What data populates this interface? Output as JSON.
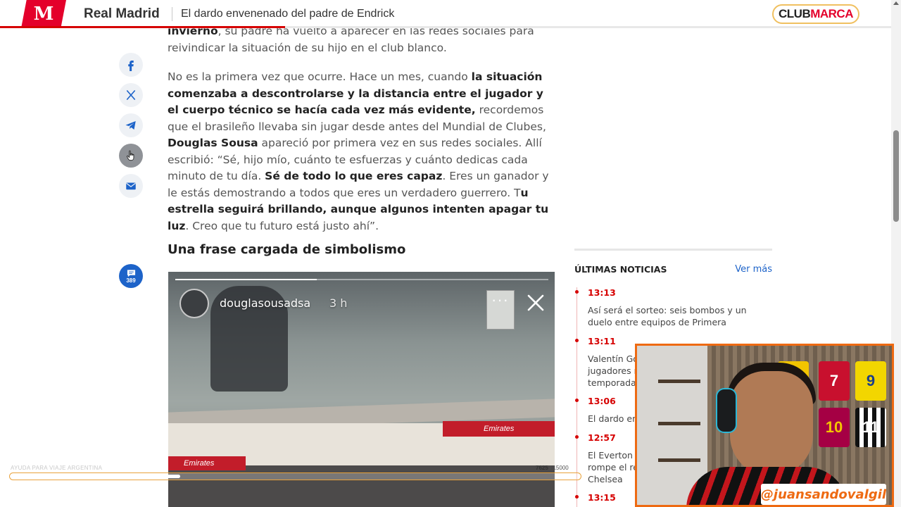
{
  "header": {
    "logo_letter": "M",
    "section": "Real Madrid",
    "article_title": "El dardo envenenado del padre de Endrick",
    "club_brand_part1": "CLUB",
    "club_brand_part2": "MARCA"
  },
  "share_rail": {
    "buttons": [
      "facebook-icon",
      "x-icon",
      "telegram-icon",
      "whatsapp-icon",
      "email-icon"
    ],
    "comments_count": "389"
  },
  "article": {
    "p1_bold": "invierno",
    "p1_rest": ", su padre ha vuelto a aparecer en las redes sociales para reivindicar la situación de su hijo en el club blanco.",
    "p2": {
      "a": "No es la primera vez que ocurre. Hace un mes, cuando ",
      "b": "la situación comenzaba a descontrolarse y la distancia entre el jugador y el cuerpo técnico se hacía cada vez más evidente,",
      "c": " recordemos que el brasileño llevaba sin jugar desde antes del Mundial de Clubes, ",
      "d": "Douglas Sousa",
      "e": " apareció por primera vez en sus redes sociales. Allí escribió: “Sé, hijo mío, cuánto te esfuerzas y cuánto dedicas cada minuto de tu día. ",
      "f": "Sé de todo lo que eres capaz",
      "g": ". Eres un ganador y le estás demostrando a todos que eres un verdadero guerrero. T",
      "h": "u estrella seguirá brillando, aunque algunos intenten apagar tu luz",
      "i": ". Creo que tu futuro está justo ahí”."
    },
    "subheading": "Una frase cargada de simbolismo"
  },
  "story_embed": {
    "username": "douglasousadsa",
    "time": "3 h",
    "more": "···",
    "brand_text": "Emirates",
    "progress": 0.38
  },
  "latest_news": {
    "heading": "ÚLTIMAS NOTICIAS",
    "see_more": "Ver más",
    "items": [
      {
        "time": "13:13",
        "headline": "Así será el sorteo: seis bombos y un duelo entre equipos de Primera"
      },
      {
        "time": "13:11",
        "headline": "Valentín Gó\njugadores r\ntemporada"
      },
      {
        "time": "13:06",
        "headline": "El dardo en"
      },
      {
        "time": "12:57",
        "headline": "El Everton\nrompe el ré\nChelsea"
      },
      {
        "time": "13:15",
        "headline": ""
      }
    ]
  },
  "webcam": {
    "handle": "@juansandovalgil",
    "jerseys": [
      "10",
      "7",
      "9",
      "10",
      "11"
    ]
  },
  "video_overlay": {
    "label": "AYUDA PARA VIAJE ARGENTINA",
    "count": "7625",
    "total": "/ 15000",
    "progress": 0.3
  },
  "colors": {
    "marca_red": "#e4002b",
    "news_red": "#d60000",
    "link_blue": "#1d63c9",
    "cam_border": "#ee6a12"
  }
}
